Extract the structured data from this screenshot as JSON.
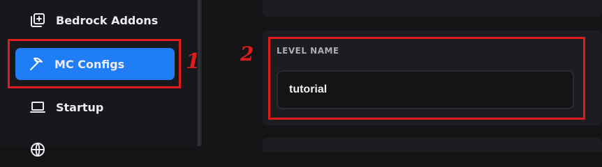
{
  "sidebar": {
    "items": [
      {
        "label": "Bedrock Addons",
        "icon": "add-box-icon"
      },
      {
        "label": "MC Configs",
        "icon": "pickaxe-icon",
        "active": true
      },
      {
        "label": "Startup",
        "icon": "laptop-icon"
      },
      {
        "label": "",
        "icon": "globe-icon"
      }
    ]
  },
  "main": {
    "level_name": {
      "label": "LEVEL NAME",
      "value": "tutorial"
    }
  },
  "annotations": {
    "marker_1": "1",
    "marker_2": "2"
  },
  "colors": {
    "accent": "#1f7ef5",
    "annotation": "#e01b1b",
    "background": "#141417",
    "card": "#1d1d21"
  }
}
